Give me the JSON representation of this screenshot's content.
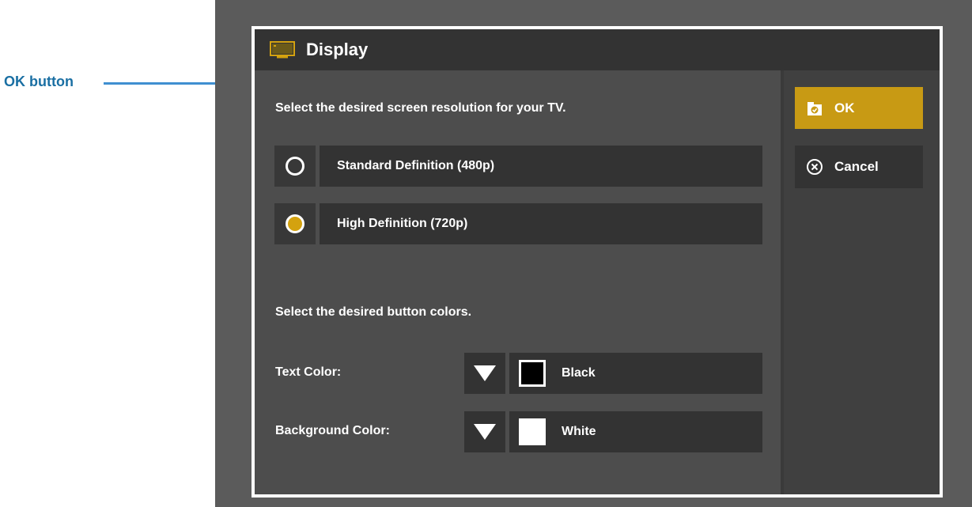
{
  "callout": {
    "label": "OK button"
  },
  "dialog": {
    "title": "Display",
    "title_icon": "tv-icon",
    "resolution_prompt": "Select the desired screen resolution for your TV.",
    "resolution_options": [
      {
        "label": "Standard Definition (480p)",
        "selected": false
      },
      {
        "label": "High Definition (720p)",
        "selected": true
      }
    ],
    "color_prompt": "Select the desired button colors.",
    "text_color": {
      "label": "Text Color:",
      "value": "Black",
      "swatch": "#000000"
    },
    "background_color": {
      "label": "Background Color:",
      "value": "White",
      "swatch": "#ffffff"
    },
    "ok_label": "OK",
    "ok_icon": "folder-check-icon",
    "cancel_label": "Cancel",
    "cancel_icon": "circle-x-icon"
  },
  "colors": {
    "accent": "#c89a14",
    "callout_text": "#1a6fa3",
    "callout_arrow": "#4b9ae0"
  }
}
